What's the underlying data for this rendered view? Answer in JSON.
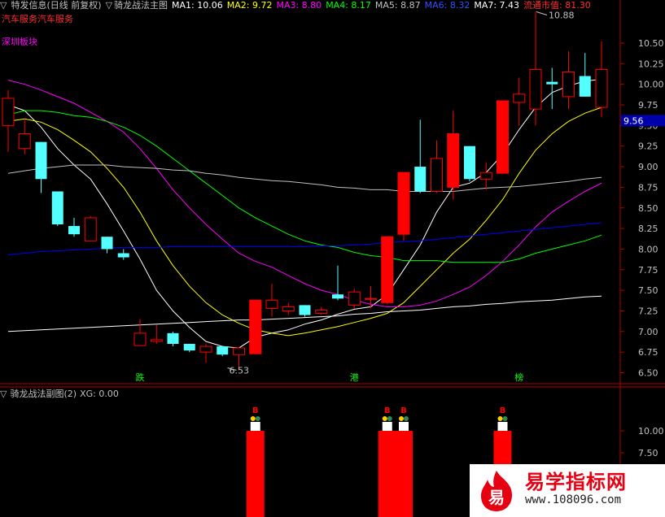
{
  "colors": {
    "bg": "#000000",
    "up": "#ff0000",
    "down": "#54ffff",
    "axis": "#b00000",
    "grid_text": "#c0c0c0",
    "ma1": "#ffffff",
    "ma2": "#ffff00",
    "ma3": "#ff00ff",
    "ma4": "#00ff00",
    "ma5": "#c0c0c0",
    "ma6": "#0000ff",
    "ma7": "#ffffff",
    "sector": "#ff00ff",
    "industry": "#ff3030",
    "cap": "#ff3030",
    "event": "#00ff00",
    "current": "#0000aa"
  },
  "header": {
    "stock_title": "特发信息(日线 前复权)",
    "main_indicator": "骑龙战法主图",
    "ma": [
      {
        "label": "MA1: 10.06",
        "color": "#ffffff"
      },
      {
        "label": "MA2: 9.72",
        "color": "#ffff00"
      },
      {
        "label": "MA3: 8.80",
        "color": "#ff00ff"
      },
      {
        "label": "MA4: 8.17",
        "color": "#00ff00"
      },
      {
        "label": "MA5: 8.87",
        "color": "#c0c0c0"
      },
      {
        "label": "MA6: 8.32",
        "color": "#0000ff"
      },
      {
        "label": "MA7: 7.43",
        "color": "#ffffff"
      }
    ],
    "cap_label": "流通市值: 81.30",
    "industry_label": "汽车服务汽车服务",
    "sector_label": "深圳板块"
  },
  "sub_header": {
    "title": "骑龙战法副图(2)",
    "xg": "XG: 0.00"
  },
  "chart_data": [
    {
      "type": "candlestick",
      "price_axis": {
        "min": 6.5,
        "max": 10.5,
        "ticks": [
          "6.50",
          "6.75",
          "7.00",
          "7.25",
          "7.50",
          "7.75",
          "8.00",
          "8.25",
          "8.50",
          "8.75",
          "9.00",
          "9.25",
          "9.50",
          "9.75",
          "10.00",
          "10.25",
          "10.50"
        ]
      },
      "current_price": "9.56",
      "high_label": "10.88",
      "low_label": "6.53",
      "candles": [
        {
          "o": 9.5,
          "h": 9.93,
          "l": 9.18,
          "c": 9.83
        },
        {
          "o": 9.22,
          "h": 9.58,
          "l": 9.15,
          "c": 9.4
        },
        {
          "o": 9.3,
          "h": 9.3,
          "l": 8.68,
          "c": 8.85
        },
        {
          "o": 8.7,
          "h": 8.7,
          "l": 8.28,
          "c": 8.3
        },
        {
          "o": 8.28,
          "h": 8.38,
          "l": 8.15,
          "c": 8.18
        },
        {
          "o": 8.1,
          "h": 8.4,
          "l": 8.1,
          "c": 8.38
        },
        {
          "o": 8.15,
          "h": 8.15,
          "l": 7.95,
          "c": 8.0
        },
        {
          "o": 7.95,
          "h": 8.0,
          "l": 7.87,
          "c": 7.9
        },
        {
          "o": 6.83,
          "h": 7.15,
          "l": 6.83,
          "c": 6.98
        },
        {
          "o": 6.88,
          "h": 7.08,
          "l": 6.85,
          "c": 6.9
        },
        {
          "o": 6.98,
          "h": 7.0,
          "l": 6.82,
          "c": 6.85
        },
        {
          "o": 6.85,
          "h": 6.85,
          "l": 6.75,
          "c": 6.77
        },
        {
          "o": 6.75,
          "h": 6.85,
          "l": 6.62,
          "c": 6.82
        },
        {
          "o": 6.82,
          "h": 6.82,
          "l": 6.7,
          "c": 6.72
        },
        {
          "o": 6.72,
          "h": 6.81,
          "l": 6.53,
          "c": 6.8
        },
        {
          "o": 6.73,
          "h": 7.38,
          "l": 6.73,
          "c": 7.38
        },
        {
          "o": 7.28,
          "h": 7.58,
          "l": 7.18,
          "c": 7.38
        },
        {
          "o": 7.25,
          "h": 7.35,
          "l": 7.2,
          "c": 7.3
        },
        {
          "o": 7.32,
          "h": 7.32,
          "l": 7.18,
          "c": 7.2
        },
        {
          "o": 7.22,
          "h": 7.3,
          "l": 7.2,
          "c": 7.26
        },
        {
          "o": 7.45,
          "h": 7.8,
          "l": 7.38,
          "c": 7.4
        },
        {
          "o": 7.32,
          "h": 7.52,
          "l": 7.28,
          "c": 7.48
        },
        {
          "o": 7.4,
          "h": 7.55,
          "l": 7.28,
          "c": 7.4
        },
        {
          "o": 7.35,
          "h": 8.15,
          "l": 7.33,
          "c": 8.15
        },
        {
          "o": 8.18,
          "h": 8.93,
          "l": 8.1,
          "c": 8.93
        },
        {
          "o": 9.0,
          "h": 9.57,
          "l": 8.68,
          "c": 8.7
        },
        {
          "o": 8.7,
          "h": 9.32,
          "l": 8.68,
          "c": 9.1
        },
        {
          "o": 8.75,
          "h": 9.68,
          "l": 8.6,
          "c": 9.4
        },
        {
          "o": 9.25,
          "h": 9.25,
          "l": 8.82,
          "c": 8.85
        },
        {
          "o": 8.85,
          "h": 9.05,
          "l": 8.72,
          "c": 8.93
        },
        {
          "o": 8.92,
          "h": 9.8,
          "l": 8.92,
          "c": 9.8
        },
        {
          "o": 9.78,
          "h": 10.08,
          "l": 9.5,
          "c": 9.88
        },
        {
          "o": 9.7,
          "h": 10.88,
          "l": 9.5,
          "c": 10.18
        },
        {
          "o": 10.03,
          "h": 10.2,
          "l": 9.7,
          "c": 10.0
        },
        {
          "o": 9.85,
          "h": 10.4,
          "l": 9.7,
          "c": 10.15
        },
        {
          "o": 10.1,
          "h": 10.38,
          "l": 9.85,
          "c": 9.85
        },
        {
          "o": 9.72,
          "h": 10.52,
          "l": 9.6,
          "c": 10.18
        }
      ],
      "ma_lines": [
        {
          "name": "MA1",
          "color": "#ffffff",
          "values": [
            9.75,
            9.68,
            9.48,
            9.22,
            9.02,
            8.85,
            8.55,
            8.22,
            7.88,
            7.5,
            7.25,
            7.05,
            6.88,
            6.82,
            6.8,
            6.93,
            6.98,
            7.02,
            7.09,
            7.14,
            7.21,
            7.27,
            7.3,
            7.45,
            7.75,
            8.05,
            8.45,
            8.75,
            8.8,
            8.93,
            9.15,
            9.45,
            9.72,
            9.9,
            9.98,
            10.04,
            10.06
          ]
        },
        {
          "name": "MA2",
          "color": "#ffff00",
          "values": [
            9.55,
            9.58,
            9.54,
            9.45,
            9.32,
            9.18,
            8.98,
            8.75,
            8.45,
            8.1,
            7.8,
            7.55,
            7.35,
            7.2,
            7.1,
            7.02,
            6.98,
            6.95,
            6.98,
            7.02,
            7.06,
            7.11,
            7.16,
            7.22,
            7.35,
            7.55,
            7.75,
            7.95,
            8.12,
            8.35,
            8.6,
            8.92,
            9.2,
            9.4,
            9.55,
            9.65,
            9.72
          ]
        },
        {
          "name": "MA3",
          "color": "#ff00ff",
          "values": [
            10.05,
            10.0,
            9.93,
            9.85,
            9.77,
            9.66,
            9.55,
            9.42,
            9.22,
            8.98,
            8.72,
            8.5,
            8.3,
            8.12,
            7.95,
            7.85,
            7.78,
            7.68,
            7.58,
            7.5,
            7.45,
            7.38,
            7.33,
            7.3,
            7.3,
            7.32,
            7.37,
            7.45,
            7.54,
            7.68,
            7.85,
            8.05,
            8.27,
            8.45,
            8.58,
            8.7,
            8.8
          ]
        },
        {
          "name": "MA4",
          "color": "#00ff00",
          "values": [
            9.63,
            9.68,
            9.68,
            9.66,
            9.62,
            9.6,
            9.55,
            9.48,
            9.38,
            9.25,
            9.1,
            8.95,
            8.8,
            8.65,
            8.5,
            8.38,
            8.28,
            8.18,
            8.1,
            8.05,
            8.02,
            7.96,
            7.92,
            7.9,
            7.86,
            7.86,
            7.86,
            7.84,
            7.84,
            7.84,
            7.84,
            7.88,
            7.95,
            8.0,
            8.05,
            8.1,
            8.17
          ]
        },
        {
          "name": "MA5",
          "color": "#c0c0c0",
          "values": [
            8.92,
            8.95,
            8.98,
            9.0,
            9.02,
            9.02,
            9.02,
            9.0,
            8.99,
            8.98,
            8.96,
            8.95,
            8.92,
            8.9,
            8.87,
            8.85,
            8.83,
            8.82,
            8.8,
            8.78,
            8.75,
            8.74,
            8.72,
            8.72,
            8.7,
            8.7,
            8.7,
            8.7,
            8.72,
            8.74,
            8.75,
            8.76,
            8.78,
            8.8,
            8.82,
            8.85,
            8.87
          ]
        },
        {
          "name": "MA6",
          "color": "#0000ff",
          "values": [
            7.93,
            7.95,
            7.97,
            7.98,
            7.99,
            8.0,
            8.01,
            8.02,
            8.02,
            8.02,
            8.03,
            8.03,
            8.03,
            8.03,
            8.03,
            8.03,
            8.03,
            8.03,
            8.03,
            8.04,
            8.04,
            8.05,
            8.06,
            8.08,
            8.09,
            8.1,
            8.12,
            8.14,
            8.16,
            8.18,
            8.2,
            8.22,
            8.24,
            8.26,
            8.28,
            8.3,
            8.32
          ]
        },
        {
          "name": "MA7",
          "color": "#ffffff",
          "values": [
            7.0,
            7.01,
            7.02,
            7.03,
            7.04,
            7.05,
            7.06,
            7.07,
            7.08,
            7.09,
            7.1,
            7.11,
            7.12,
            7.13,
            7.14,
            7.14,
            7.15,
            7.16,
            7.17,
            7.18,
            7.19,
            7.21,
            7.22,
            7.24,
            7.25,
            7.26,
            7.28,
            7.3,
            7.31,
            7.33,
            7.34,
            7.36,
            7.37,
            7.38,
            7.4,
            7.42,
            7.43
          ]
        }
      ],
      "event_labels": [
        {
          "index": 8,
          "text": "跌"
        },
        {
          "index": 21,
          "text": "港"
        },
        {
          "index": 31,
          "text": "榜"
        }
      ]
    },
    {
      "type": "bar",
      "y_axis": {
        "ticks": [
          "10.00",
          "7.50"
        ]
      },
      "bars": [
        {
          "index": 15,
          "value": 1
        },
        {
          "index": 23,
          "value": 1
        },
        {
          "index": 24,
          "value": 1
        },
        {
          "index": 30,
          "value": 1
        }
      ],
      "bar_marker": "B"
    }
  ],
  "watermark": {
    "title": "易学指标网",
    "url": "www.108096.com",
    "seal": "易"
  }
}
